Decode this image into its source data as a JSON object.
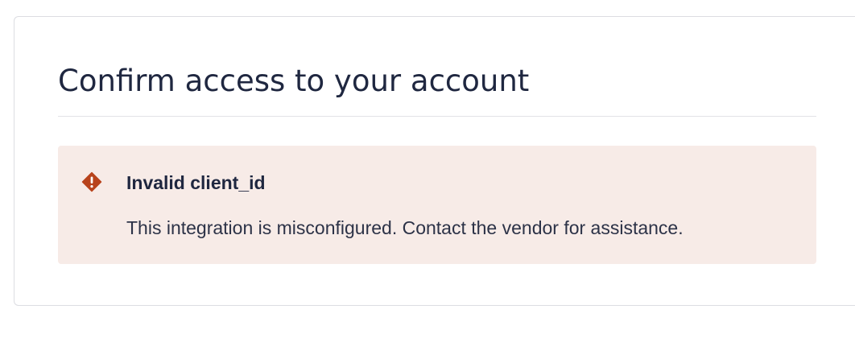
{
  "page": {
    "title": "Confirm access to your account"
  },
  "alert": {
    "icon": "error-diamond-icon",
    "title": "Invalid client_id",
    "message": "This integration is misconfigured. Contact the vendor for assistance."
  },
  "colors": {
    "text": "#1f2740",
    "alert_background": "#f7ebe7",
    "alert_icon": "#b8431c",
    "card_border": "#dcdde2"
  }
}
